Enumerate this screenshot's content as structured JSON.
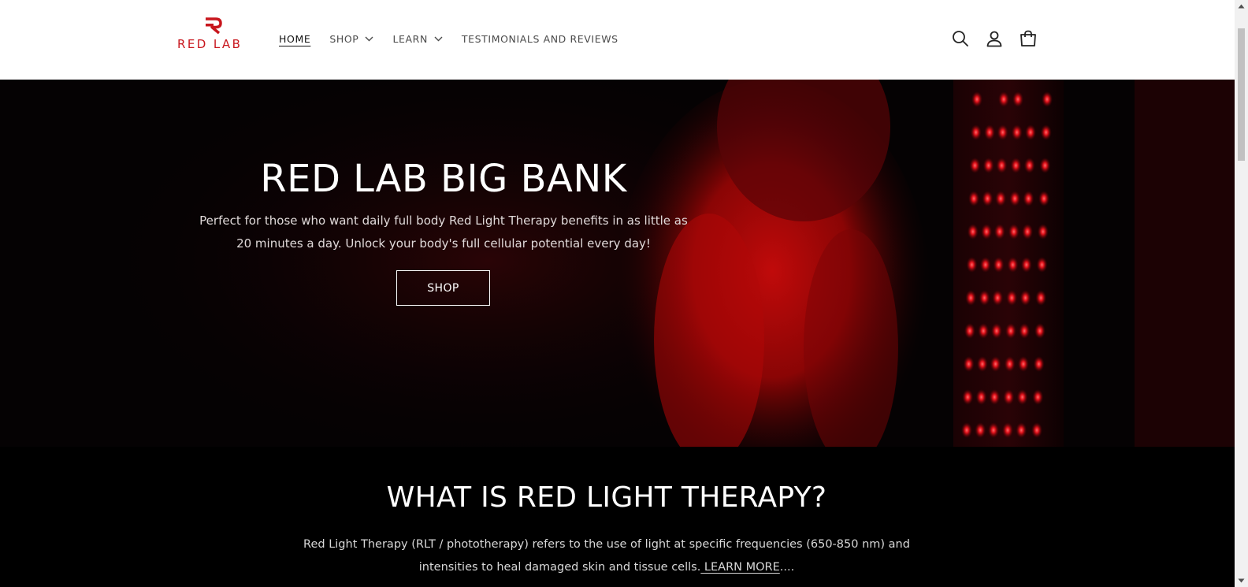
{
  "header": {
    "logo": {
      "mark": "R",
      "text": "RED LAB"
    },
    "nav": [
      {
        "label": "HOME",
        "active": true,
        "dropdown": false
      },
      {
        "label": "SHOP",
        "active": false,
        "dropdown": true
      },
      {
        "label": "LEARN",
        "active": false,
        "dropdown": true
      },
      {
        "label": "TESTIMONIALS AND REVIEWS",
        "active": false,
        "dropdown": false
      }
    ],
    "icons": [
      "search-icon",
      "account-icon",
      "cart-icon"
    ]
  },
  "hero": {
    "title": "RED LAB BIG BANK",
    "description": "Perfect for those who want daily full body Red Light Therapy benefits in as little as 20 minutes a day. Unlock your body's full cellular potential every day!",
    "button_label": "SHOP"
  },
  "section": {
    "title": "WHAT IS RED LIGHT THERAPY?",
    "text_before_link": "Red Light Therapy (RLT / phototherapy) refers to the use of light at specific frequencies (650-850 nm) and intensities to heal damaged skin and tissue cells.",
    "link_label": " LEARN MORE",
    "text_after_link": "...."
  },
  "colors": {
    "brand_red": "#c8161d",
    "hero_bg": "#050203",
    "section_bg": "#000000"
  }
}
